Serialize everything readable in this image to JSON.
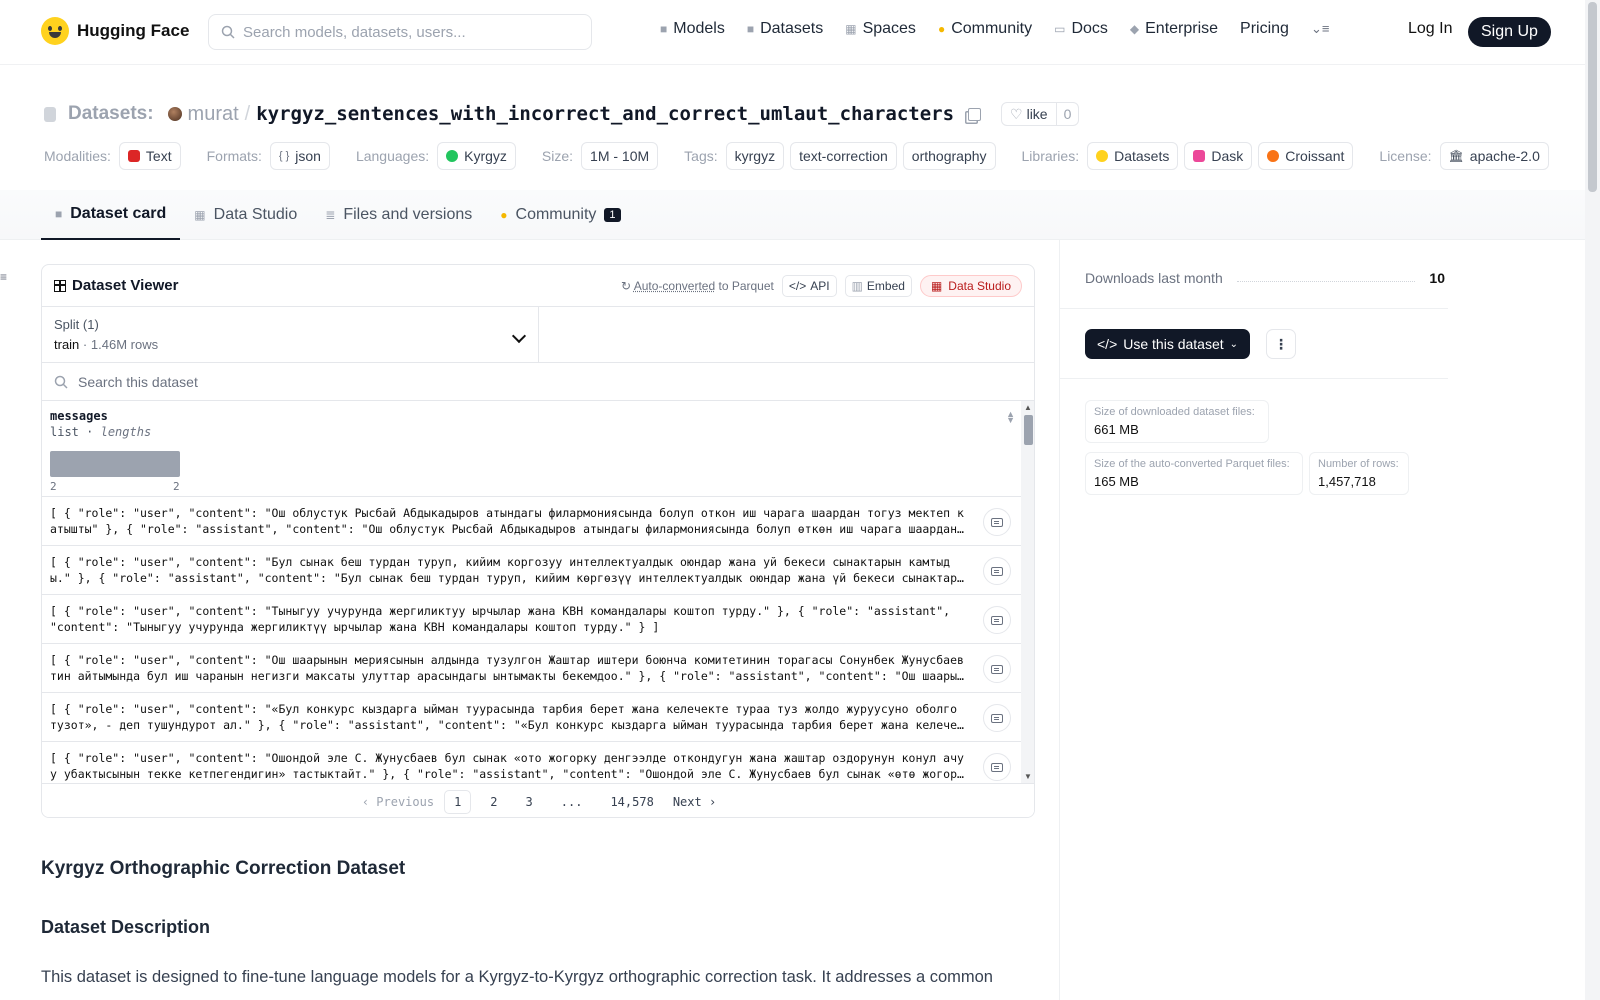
{
  "header": {
    "brand": "Hugging Face",
    "search_placeholder": "Search models, datasets, users...",
    "nav": [
      {
        "label": "Models",
        "icon": "model-icon"
      },
      {
        "label": "Datasets",
        "icon": "dataset-icon"
      },
      {
        "label": "Spaces",
        "icon": "spaces-icon"
      },
      {
        "label": "Community",
        "icon": "community-icon"
      },
      {
        "label": "Docs",
        "icon": "docs-icon"
      },
      {
        "label": "Enterprise",
        "icon": "enterprise-icon"
      },
      {
        "label": "Pricing",
        "icon": ""
      }
    ],
    "login": "Log In",
    "signup": "Sign Up"
  },
  "title": {
    "label": "Datasets:",
    "owner": "murat",
    "separator": "/",
    "repo": "kyrgyz_sentences_with_incorrect_and_correct_umlaut_characters",
    "like_label": "like",
    "like_count": "0"
  },
  "tags": {
    "modalities_label": "Modalities:",
    "modalities": [
      "Text"
    ],
    "formats_label": "Formats:",
    "formats": [
      "json"
    ],
    "languages_label": "Languages:",
    "languages": [
      "Kyrgyz"
    ],
    "size_label": "Size:",
    "size": [
      "1M - 10M"
    ],
    "tags_label": "Tags:",
    "tags": [
      "kyrgyz",
      "text-correction",
      "orthography"
    ],
    "libraries_label": "Libraries:",
    "libraries": [
      "Datasets",
      "Dask",
      "Croissant"
    ],
    "license_label": "License:",
    "license": [
      "apache-2.0"
    ]
  },
  "tabs": [
    {
      "label": "Dataset card",
      "active": true
    },
    {
      "label": "Data Studio"
    },
    {
      "label": "Files and versions"
    },
    {
      "label": "Community",
      "badge": "1"
    }
  ],
  "viewer": {
    "title": "Dataset Viewer",
    "auto_converted": "Auto-converted",
    "to_parquet": "to Parquet",
    "api": "API",
    "embed": "Embed",
    "data_studio": "Data Studio",
    "split_label": "Split (1)",
    "split_name": "train",
    "split_sep": "·",
    "split_rows": "1.46M rows",
    "search_placeholder": "Search this dataset",
    "column": {
      "name": "messages",
      "type": "list",
      "sep": "·",
      "subtype": "lengths",
      "hist_min": "2",
      "hist_max": "2"
    },
    "rows": [
      "[ { \"role\": \"user\", \"content\": \"Ош облустук Рысбай Абдыкадыров атындагы филармониясында болуп откон  иш чарага шаардан тогуз мектеп катышты\" }, { \"role\": \"assistant\", \"content\": \"Ош облустук Рысбай Абдыкадыров атындагы филармониясында болуп өткөн  иш чарагa шаардан тогуз мектеп катышты\" } ]",
      "[ { \"role\": \"user\", \"content\": \"Бул сынак беш турдан  туруп, кийим  коргозуу интеллектуалдык оюндар жана  уй бекеси сынактарын камтыды.\" }, { \"role\": \"assistant\", \"content\": \"Бул сынак беш турдан  туруп, кийим  көргөзүү интеллектуалдык оюндар жана  үй бекеси сынактарын камтыды.\" } ]",
      "[ { \"role\": \"user\", \"content\": \"Тыныгуу учурунда  жергиликтуу ырчылар  жана КВН командалары коштоп турду.\" }, { \"role\": \"assistant\", \"content\": \"Тыныгуу учурунда  жергиликтүү ырчылар  жана КВН командалары коштоп турду.\" } ]",
      "[ { \"role\": \"user\", \"content\": \"Ош шаарынын мериясынын алдында тузулгон  Жаштар иштери боюнча  комитетинин торагасы Сонунбек Жунусбаевтин  айтымында  бул иш чаранын негизги максаты  улуттар арасындагы  ынтымакты бекемдоо.\" }, { \"role\": \"assistant\", \"content\": \"Ош шаарынын мериясынын алдында түзүлгөн\" } ]",
      "[ { \"role\": \"user\", \"content\": \"«Бул конкурс кыздарга ыйман туурасында тарбия берет жана келечекте турaa туз жолдо журуусуно оболго тузот», - деп тушундурот ал.\" }, { \"role\": \"assistant\", \"content\": \"«Бул конкурс кыздарга ыйман туурасында тарбия берет жана келечекте\" } ]",
      "[ { \"role\": \"user\", \"content\": \"Ошондой эле С. Жунусбаев бул сынак  «ото жогорку денгээлде откондугун жана жаштар оздорунун конул ачуу  убактысынын  текке кетпегендигин» тастыктайт.\" }, { \"role\": \"assistant\", \"content\": \"Ошондой эле С. Жунусбаев бул сынак  «өтө жогорку деңгээлде\" } ]"
    ],
    "pager": {
      "prev": "Previous",
      "pages": [
        "1",
        "2",
        "3",
        "...",
        "14,578"
      ],
      "next": "Next"
    }
  },
  "content": {
    "h2": "Kyrgyz Orthographic Correction Dataset",
    "h3": "Dataset Description",
    "para": "This dataset is designed to fine-tune language models for a Kyrgyz-to-Kyrgyz orthographic correction task. It addresses a common"
  },
  "sidebar": {
    "downloads_label": "Downloads last month",
    "downloads_value": "10",
    "use_dataset": "Use this dataset",
    "more": "⋮",
    "stats": [
      {
        "label": "Size of downloaded dataset files:",
        "value": "661 MB"
      },
      {
        "label": "Size of the auto-converted Parquet files:",
        "value": "165 MB"
      },
      {
        "label": "Number of rows:",
        "value": "1,457,718"
      }
    ]
  }
}
